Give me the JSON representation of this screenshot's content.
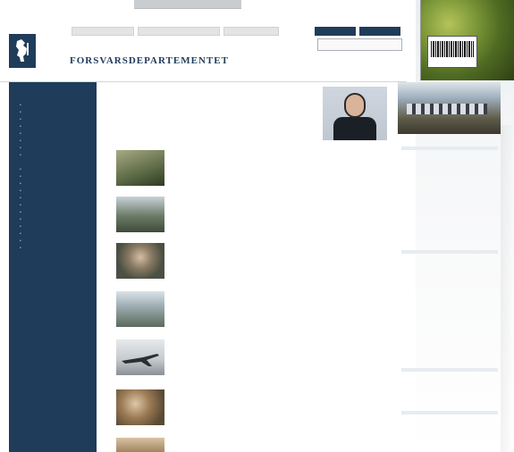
{
  "header": {
    "site_title": "FORSVARSDEPARTEMENTET",
    "nav_tabs": [
      "",
      "",
      ""
    ],
    "top_link": "",
    "buttons": [
      "",
      ""
    ],
    "search_placeholder": "",
    "language_link": ""
  },
  "colors": {
    "primary": "#1f3c5b",
    "link": "#2a4d7a",
    "accent_bg": "#e7ecf1"
  },
  "sidebar": {
    "heading": "",
    "sections": [
      {
        "title": "",
        "items": [
          "",
          "",
          "",
          "",
          "",
          "",
          "",
          ""
        ]
      },
      {
        "title": "",
        "items": [
          "",
          "",
          "",
          "",
          "",
          "",
          "",
          "",
          "",
          "",
          "",
          ""
        ]
      }
    ],
    "plain_links": [
      "",
      "",
      "",
      "",
      ""
    ]
  },
  "main": {
    "intro": "",
    "minister": {
      "label": "",
      "name": "",
      "links": [
        "",
        "",
        ""
      ]
    },
    "news": [
      {
        "title": "",
        "date": "",
        "body": "",
        "icon": "soldiers-thumb"
      },
      {
        "title": "",
        "date": "",
        "body": "",
        "icon": "vehicles-thumb"
      },
      {
        "title": "",
        "date": "",
        "body": "",
        "icon": "people-thumb"
      },
      {
        "title": "",
        "date": "",
        "body": "",
        "icon": "building-thumb"
      },
      {
        "title": "",
        "date": "",
        "body": "",
        "icon": "jet-thumb"
      },
      {
        "title": "",
        "date": "",
        "body": "",
        "icon": "uniform-thumb"
      },
      {
        "title": "",
        "date": "",
        "body": "",
        "icon": "document-thumb"
      }
    ]
  },
  "right_column": {
    "sections": [
      {
        "title": "",
        "items": [
          "",
          "",
          "",
          "",
          "",
          "",
          "",
          "",
          "",
          ""
        ]
      },
      {
        "title": "",
        "items": [
          "",
          "",
          "",
          "",
          "",
          ""
        ]
      },
      {
        "title": "",
        "items": [
          "",
          ""
        ]
      },
      {
        "title": "",
        "items": [
          ""
        ]
      }
    ]
  },
  "overlay": {
    "ebook_text": "",
    "icons": [
      "barcode-icon",
      "foliage-image"
    ]
  }
}
